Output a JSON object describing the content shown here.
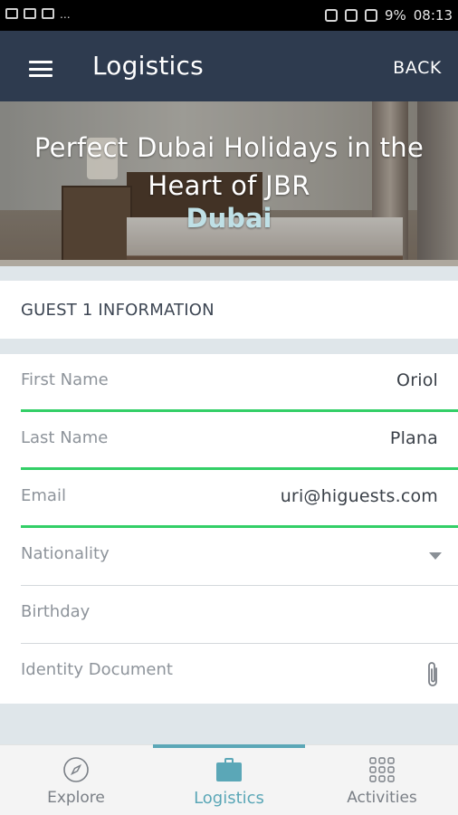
{
  "status_bar": {
    "battery_percent": "9%",
    "time": "08:13",
    "ellipsis": "..."
  },
  "app_bar": {
    "title": "Logistics",
    "back_label": "BACK"
  },
  "hero": {
    "title": "Perfect Dubai Holidays in the Heart of JBR",
    "city": "Dubai"
  },
  "section": {
    "title": "GUEST 1 INFORMATION"
  },
  "form": {
    "first_name": {
      "label": "First Name",
      "value": "Oriol"
    },
    "last_name": {
      "label": "Last Name",
      "value": "Plana"
    },
    "email": {
      "label": "Email",
      "value": "uri@higuests.com"
    },
    "nationality": {
      "label": "Nationality"
    },
    "birthday": {
      "label": "Birthday"
    },
    "identity_document": {
      "label": "Identity Document"
    }
  },
  "tabs": [
    {
      "label": "Explore",
      "icon": "compass-icon",
      "active": false
    },
    {
      "label": "Logistics",
      "icon": "suitcase-icon",
      "active": true
    },
    {
      "label": "Activities",
      "icon": "grid-icon",
      "active": false
    }
  ],
  "colors": {
    "app_bar": "#2e3b4f",
    "accent": "#5ba7b7",
    "valid_underline": "#33cf67",
    "city": "#bfe0e6"
  }
}
